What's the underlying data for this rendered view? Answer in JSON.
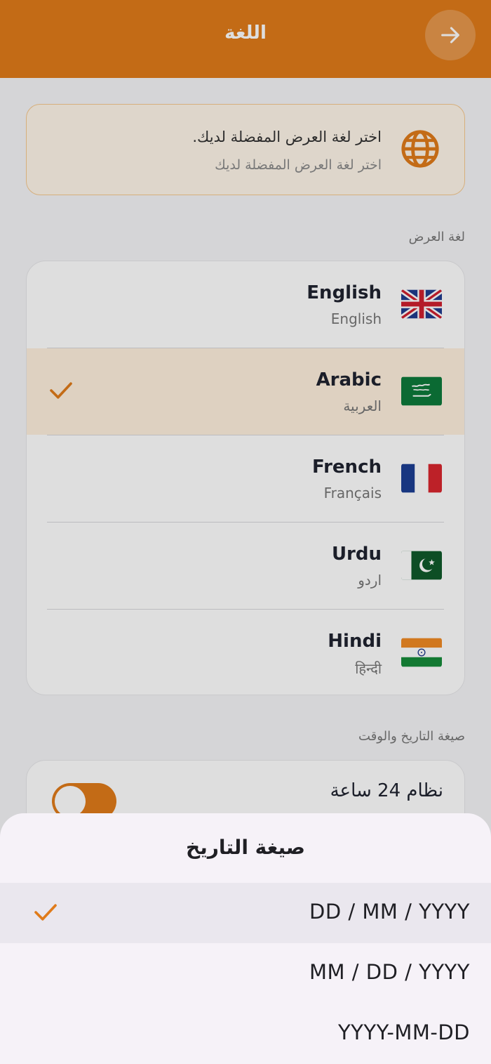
{
  "header": {
    "title": "اللغة",
    "back_icon": "arrow-right-icon"
  },
  "info": {
    "icon": "globe-icon",
    "title": "اختر لغة العرض المفضلة لديك.",
    "subtitle": "اختر لغة العرض المفضلة لديك"
  },
  "display_language": {
    "label": "لغة العرض",
    "items": [
      {
        "name": "English",
        "native": "English",
        "flag": "uk-flag-icon",
        "selected": false
      },
      {
        "name": "Arabic",
        "native": "العربية",
        "flag": "saudi-flag-icon",
        "selected": true
      },
      {
        "name": "French",
        "native": "Français",
        "flag": "france-flag-icon",
        "selected": false
      },
      {
        "name": "Urdu",
        "native": "اردو",
        "flag": "pakistan-flag-icon",
        "selected": false
      },
      {
        "name": "Hindi",
        "native": "हिन्दी",
        "flag": "india-flag-icon",
        "selected": false
      }
    ]
  },
  "date_time": {
    "label": "صيغة التاريخ والوقت",
    "hour24_label": "نظام 24 ساعة",
    "hour24_on": true
  },
  "sheet": {
    "title": "صيغة التاريخ",
    "options": [
      {
        "label": "DD / MM / YYYY",
        "selected": true
      },
      {
        "label": "MM / DD / YYYY",
        "selected": false
      },
      {
        "label": "YYYY-MM-DD",
        "selected": false
      }
    ]
  },
  "colors": {
    "accent": "#e07b1a",
    "selected_row": "#fff1de",
    "sheet_bg": "#f6f2f8"
  }
}
